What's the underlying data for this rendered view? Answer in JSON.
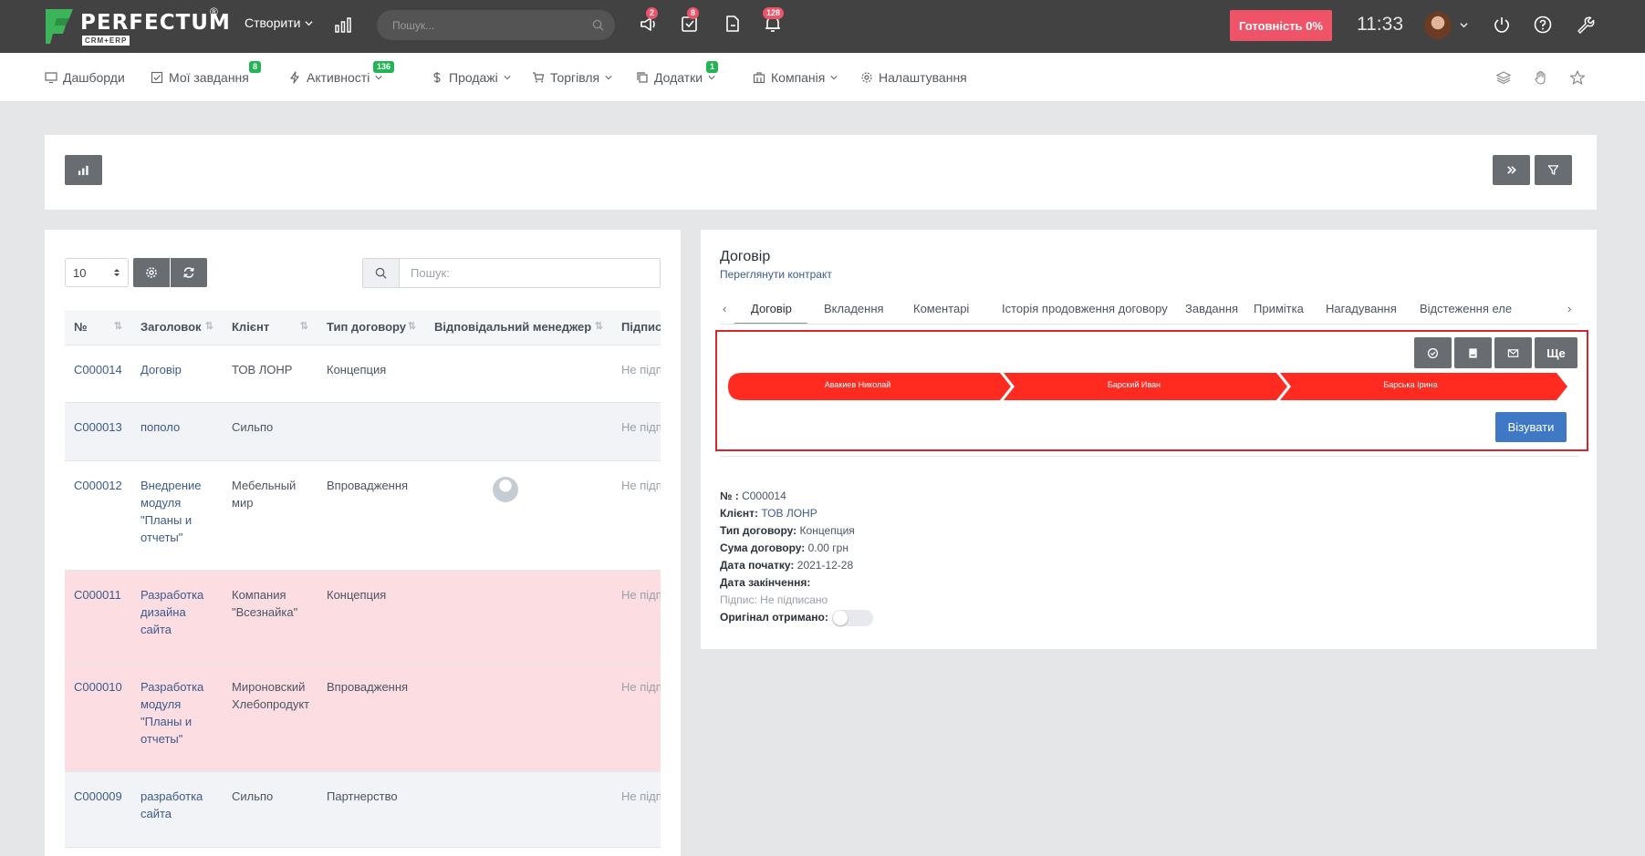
{
  "topbar": {
    "logo_text": "PERFECTUM",
    "logo_reg": "®",
    "logo_sub": "CRM+ERP",
    "create_label": "Створити",
    "search_placeholder": "Пошук...",
    "announcements_badge": "2",
    "tasks_badge": "8",
    "notifications_badge": "128",
    "ready_label": "Готовність 0%",
    "clock": "11:33"
  },
  "nav": {
    "items": [
      {
        "label": "Дашборди",
        "icon": "monitor-icon"
      },
      {
        "label": "Мої завдання",
        "icon": "checkbox-icon",
        "badge": "8"
      },
      {
        "label": "Активності",
        "icon": "lightning-icon",
        "badge": "136"
      },
      {
        "label": "Продажі",
        "icon": "dollar-icon"
      },
      {
        "label": "Торгівля",
        "icon": "cart-icon"
      },
      {
        "label": "Додатки",
        "icon": "copy-icon",
        "badge": "1"
      },
      {
        "label": "Компанія",
        "icon": "building-icon"
      },
      {
        "label": "Налаштування",
        "icon": "gear-icon"
      }
    ]
  },
  "list": {
    "page_size": "10",
    "search_placeholder": "Пошук:",
    "columns": [
      "№",
      "Заголовок",
      "Клієнт",
      "Тип договору",
      "Відповідальний менеджер",
      "Підпис"
    ],
    "rows": [
      {
        "num": "C000014",
        "title": "Договір",
        "client": "ТОВ ЛОНР",
        "type": "Концепция",
        "sign": "Не підп"
      },
      {
        "num": "C000013",
        "title": "пополо",
        "client": "Сильпо",
        "type": "",
        "sign": "Не підп"
      },
      {
        "num": "C000012",
        "title": "Внедрение модуля \"Планы и отчеты\"",
        "client": "Мебельный мир",
        "type": "Впровадження",
        "sign": "Не підп"
      },
      {
        "num": "C000011",
        "title": "Разработка дизайна сайта",
        "client": "Компания \"Всезнайка\"",
        "type": "Концепция",
        "sign": "Не підп"
      },
      {
        "num": "C000010",
        "title": "Разработка модуля \"Планы и отчеты\"",
        "client": "Мироновский Хлебопродукт",
        "type": "Впровадження",
        "sign": "Не підп"
      },
      {
        "num": "C000009",
        "title": "разработка сайта",
        "client": "Сильпо",
        "type": "Партнерство",
        "sign": "Не підп"
      }
    ]
  },
  "detail": {
    "title": "Договір",
    "subtitle": "Переглянути контракт",
    "tabs": [
      "Договір",
      "Вкладення",
      "Коментарі",
      "Історія продовження договору",
      "Завдання",
      "Примітка",
      "Нагадування",
      "Відстеження еле"
    ],
    "more_label": "Ще",
    "approvers": [
      "Авакиев Николай",
      "Барский Иван",
      "Барська Ірина"
    ],
    "visa_label": "Візувати",
    "fields": {
      "num_label": "№ :",
      "num": "C000014",
      "client_label": "Клієнт:",
      "client": "ТОВ ЛОНР",
      "type_label": "Тип договору:",
      "type": "Концепция",
      "sum_label": "Сума договору:",
      "sum": "0.00 грн",
      "start_label": "Дата початку:",
      "start": "2021-12-28",
      "end_label": "Дата закінчення:",
      "sign_label": "Підпис:",
      "sign": "Не підписано",
      "original_label": "Оригінал отримано:"
    }
  },
  "colors": {
    "topbar": "#424242",
    "accent_red": "#ef5367",
    "approval_red": "#ff2b20",
    "visa_blue": "#3f79c6",
    "badge_green": "#23b456",
    "row_pink": "#fbdde2"
  }
}
